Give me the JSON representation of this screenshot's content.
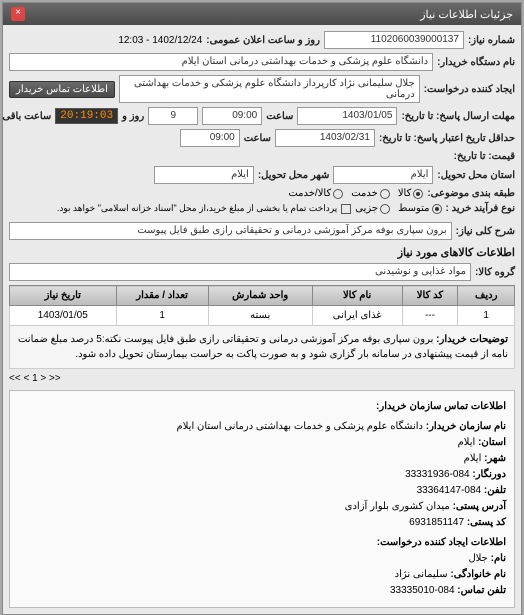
{
  "window": {
    "title": "جزئیات اطلاعات نیاز",
    "close": "×"
  },
  "header": {
    "req_number_label": "شماره نیاز:",
    "req_number": "1102060039000137",
    "announce_label": "روز و ساعت اعلان عمومی:",
    "announce_value": "1402/12/24 - 12:03",
    "buyer_label": "نام دستگاه خریدار:",
    "buyer": "دانشگاه علوم پزشکی و خدمات بهداشتی درمانی استان ایلام",
    "creator_label": "ایجاد کننده درخواست:",
    "creator": "جلال سلیمانی نژاد کارپرداز دانشگاه علوم پزشکی و خدمات بهداشتی درمانی",
    "contact_btn": "اطلاعات تماس خریدار"
  },
  "deadlines": {
    "response_label": "مهلت ارسال پاسخ: تا تاریخ:",
    "response_date": "1403/01/05",
    "response_time_label": "ساعت",
    "response_time": "09:00",
    "days_label": "روز و",
    "days_value": "9",
    "remain_label": "ساعت باقی مانده",
    "remain_time": "20:19:03",
    "valid_label": "حداقل تاریخ اعتبار پاسخ: تا تاریخ:",
    "valid_date": "1403/02/31",
    "valid_time": "09:00",
    "price_label": "قیمت: تا تاریخ:",
    "location_label": "استان محل تحویل:",
    "location": "ایلام",
    "city_label": "شهر محل تحویل:",
    "city": "ایلام"
  },
  "budget": {
    "pack_label": "طبقه بندی موضوعی:",
    "goods_label": "کالا",
    "service_label": "خدمت",
    "both_label": "کالا/خدمت",
    "purchase_type_label": "نوع فرآیند خرید :",
    "medium_label": "متوسط",
    "partial_label": "جزیی",
    "note": "پرداخت تمام یا بخشی از مبلغ خرید،از محل \"اسناد خزانه اسلامی\" خواهد بود."
  },
  "desc": {
    "title_label": "شرح کلی نیاز:",
    "title": "برون سپاری بوفه مرکز آموزشی درمانی و تحقیقاتی رازی طبق فایل پیوست"
  },
  "goods": {
    "section_title": "اطلاعات کالاهای مورد نیاز",
    "group_label": "گروه کالا:",
    "group": "مواد غذایی و نوشیدنی"
  },
  "table": {
    "headers": {
      "row": "ردیف",
      "code": "کد کالا",
      "name": "نام کالا",
      "unit": "واحد شمارش",
      "qty": "تعداد / مقدار",
      "date": "تاریخ نیاز"
    },
    "rows": [
      {
        "row": "1",
        "code": "---",
        "name": "غذای ایرانی",
        "unit": "بسته",
        "qty": "1",
        "date": "1403/01/05"
      }
    ],
    "note_label": "توضیحات خریدار:",
    "note_text": "برون سپاری بوفه مرکز آموزشی درمانی و تحقیقاتی رازی طبق فایل پیوست نکته:5 درصد مبلغ ضمانت نامه از قیمت پیشنهادی در سامانه بار گزاری شود و به صورت پاکت به حراست بیمارستان تحویل داده شود."
  },
  "pager": {
    "page": "<< < 1 > >>"
  },
  "contact": {
    "title": "اطلاعات تماس سازمان خریدار:",
    "org_label": "نام سازمان خریدار:",
    "org": "دانشگاه علوم پزشکی و خدمات بهداشتی درمانی استان ایلام",
    "province_label": "استان:",
    "province": "ایلام",
    "city_label": "شهر:",
    "city": "ایلام",
    "fax_label": "دورنگار:",
    "fax": "084-33331936",
    "phone_label": "تلفن:",
    "phone": "084-33364147",
    "address_label": "آدرس پستی:",
    "address": "میدان کشوری بلوار آزادی",
    "postal_label": "کد پستی:",
    "postal": "6931851147",
    "creator_section": "اطلاعات ایجاد کننده درخواست:",
    "name_label": "نام:",
    "name": "جلال",
    "family_label": "نام خانوادگی:",
    "family": "سلیمانی نژاد",
    "tel_label": "تلفن تماس:",
    "tel": "084-33335010"
  }
}
